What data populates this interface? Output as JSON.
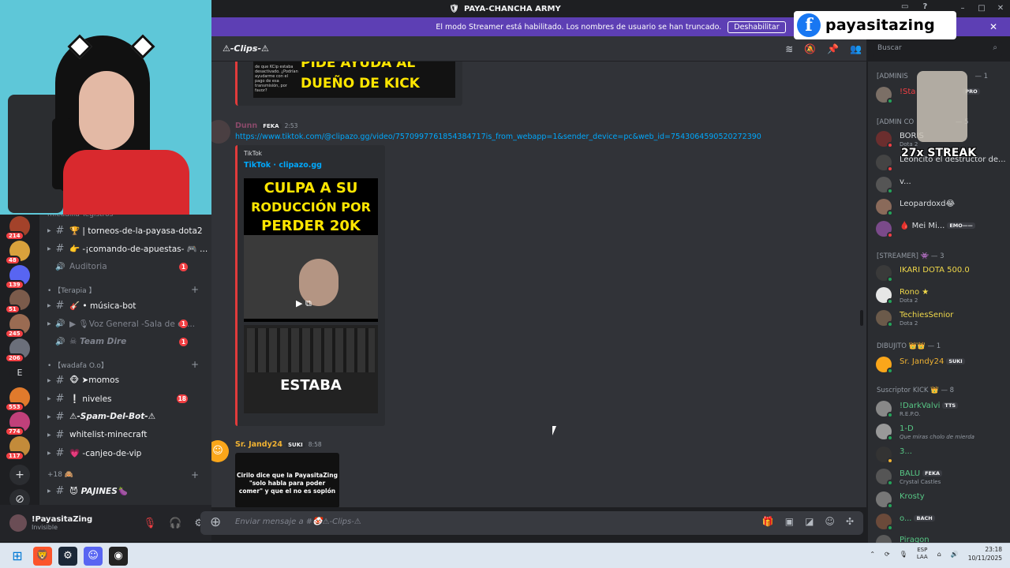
{
  "window": {
    "title": "PAYA-CHANCHA ARMY",
    "controls": [
      "–",
      "□",
      "✕"
    ]
  },
  "banner": {
    "text": "El modo Streamer está habilitado. Los nombres de usuario se han truncado.",
    "button": "Deshabilitar"
  },
  "overlay": {
    "fb_name": "payasitazing",
    "streak": "27x STREAK"
  },
  "guilds": [
    {
      "badge": "214"
    },
    {
      "badge": "48"
    },
    {
      "badge": "139"
    },
    {
      "badge": "51"
    },
    {
      "badge": "245"
    },
    {
      "badge": "206"
    },
    {
      "letter": "E"
    },
    {
      "badge": "553"
    },
    {
      "badge": "774"
    },
    {
      "badge": "117"
    }
  ],
  "guild_actions": {
    "add": "+",
    "explore": "⊘"
  },
  "channels": {
    "top_partial": "mieaallia Tegistros",
    "items": [
      {
        "icon": "#",
        "label": "🏆 | torneos-de-la-payasa-dota2"
      },
      {
        "icon": "#",
        "label": "👉 -¡comando-de-apuestas- 🎮 ..."
      },
      {
        "icon": "🔊",
        "label": "Auditoria",
        "count": "1"
      }
    ],
    "cat_terapia": "• 【Terapia 】",
    "terapia_items": [
      {
        "icon": "#",
        "label": "🎸 • música-bot"
      },
      {
        "icon": "🔊",
        "label": "▶ 🎙Voz General -Sala de es...",
        "count": "1"
      },
      {
        "icon": "🔊",
        "label": "☠ Team Dire",
        "count": "1"
      }
    ],
    "cat_wadafa": "• 【wadafa O.o】",
    "wadafa_items": [
      {
        "icon": "#",
        "label": "🐵 ➤momos"
      },
      {
        "icon": "#",
        "label": "❕ niveles",
        "count": "18"
      },
      {
        "icon": "#",
        "label": "⚠-Spam-Del-Bot-⚠"
      },
      {
        "icon": "#",
        "label": "whitelist-minecraft"
      },
      {
        "icon": "#",
        "label": "💗 -canjeo-de-vip"
      }
    ],
    "cat_18": "+18 🙈",
    "bottom_item": {
      "icon": "#",
      "label": "😈 PAJINES🍆"
    }
  },
  "user": {
    "name": "!PayasitaZing",
    "status": "Invisible"
  },
  "chat": {
    "channel_name": "⚠-Clips-⚠",
    "search_placeholder": "Buscar",
    "embed1": {
      "line1": "PIDE AYUDA AL",
      "line2": "DUEÑO DE KICK",
      "small": "de que KCip estaba desactivado. ¿Podrían ayudarme con el pago de esa transmisión, por favor?"
    },
    "msg1": {
      "author": "Dunn",
      "tag": "FEKA",
      "time": "2:53",
      "link": "https://www.tiktok.com/@clipazo.gg/video/7570997761854384717is_from_webapp=1&sender_device=pc&web_id=7543064590520272390",
      "provider": "TikTok",
      "embed_title": "TikTok · clipazo.gg",
      "caption1": "CULPA A SU",
      "caption2": "RODUCCIÓN POR",
      "caption3": "PERDER 20K",
      "caption4": "ESTABA"
    },
    "msg2": {
      "author": "Sr. Jandy24",
      "tag": "SUKI",
      "time": "8:58",
      "image_text": "Cirilo dice que la PayasitaZing \"solo habla para poder comer\" y que el no es soplón"
    },
    "composer_placeholder": "Enviar mensaje a #🤡⚠-Clips-⚠"
  },
  "members": {
    "cat_admin1": "[ADMINIS",
    "cat_admin1_count": "— 1",
    "cat_admin2": "[ADMIN CO",
    "cat_admin2_count": "— 5",
    "cat_streamer": "[STREAMER] 👾 — 3",
    "cat_dibujito": "DIBUJITO 👑👑 — 1",
    "cat_suscriptor": "Suscriptor KICK 👑 — 8",
    "list": [
      {
        "name": "!Sta",
        "tag": "PRO",
        "sub": ""
      },
      {
        "name": "BORIS",
        "sub": "Dota 2"
      },
      {
        "name": "Leoncito el destructor de...",
        "sub": ""
      },
      {
        "name": "v...",
        "sub": ""
      },
      {
        "name": "Leopardoxd😂",
        "sub": ""
      },
      {
        "name": "🩸 Mei Mi...",
        "tag": "EMO——",
        "sub": ""
      },
      {
        "name": "IKARI DOTA 500.0",
        "sub": ""
      },
      {
        "name": "Rono ★",
        "sub": "Dota 2"
      },
      {
        "name": "TechiesSenior",
        "sub": "Dota 2"
      },
      {
        "name": "Sr. Jandy24",
        "tag": "SUKI",
        "sub": ""
      },
      {
        "name": "!DarkValvi",
        "tag": "TTS",
        "sub": "R.E.P.O."
      },
      {
        "name": "1-D",
        "sub": "Que miras cholo de mierda"
      },
      {
        "name": "3...",
        "sub": ""
      },
      {
        "name": "BALU",
        "tag": "FEKA",
        "sub": "Crystal Castles"
      },
      {
        "name": "Krosty",
        "sub": ""
      },
      {
        "name": "o...",
        "tag": "BACH",
        "sub": ""
      },
      {
        "name": "Piragon",
        "sub": ""
      }
    ]
  },
  "taskbar": {
    "lang1": "ESP",
    "lang2": "LAA",
    "time": "23:18",
    "date": "10/11/2025"
  },
  "colors": {
    "banner": "#5d3fb4",
    "accent": "#5865f2",
    "link": "#00a8fc",
    "badge": "#f23f43",
    "online": "#23a55a"
  }
}
